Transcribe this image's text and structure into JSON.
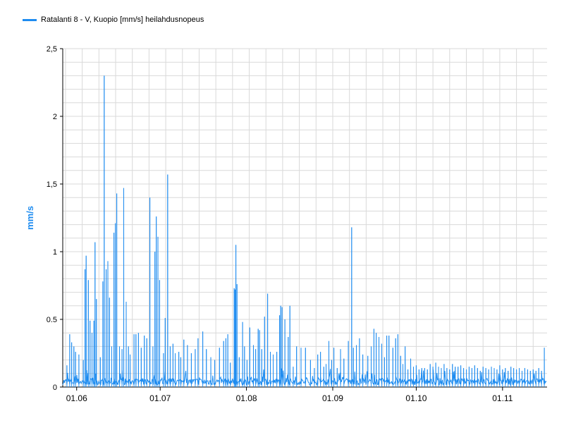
{
  "legend": {
    "label": "Ratalanti 8 - V, Kuopio [mm/s] heilahdusnopeus"
  },
  "colors": {
    "series": "#1e8cf0",
    "axis_label": "#1e8cf0",
    "grid": "#d9d9d9",
    "axis": "#000000"
  },
  "chart_data": {
    "type": "line",
    "title": "",
    "xlabel": "",
    "ylabel": "mm/s",
    "ylim": [
      0,
      2.5
    ],
    "yticks": [
      "0",
      "0.5",
      "1",
      "1,5",
      "2",
      "2,5"
    ],
    "ytick_values": [
      0,
      0.5,
      1,
      1.5,
      2,
      2.5
    ],
    "xticks": [
      "01.06",
      "01.07",
      "01.08",
      "01.09",
      "01.10",
      "01.11"
    ],
    "xtick_days": [
      31,
      61,
      92,
      123,
      153,
      184
    ],
    "xlim_days": [
      26,
      200
    ],
    "grid": true,
    "legend_position": "top-left",
    "series": [
      {
        "name": "Ratalanti 8 - V, Kuopio [mm/s] heilahdusnopeus",
        "spikes": [
          [
            27.5,
            0.16
          ],
          [
            28.5,
            0.39
          ],
          [
            29.2,
            0.33
          ],
          [
            30,
            0.3
          ],
          [
            30.6,
            0.26
          ],
          [
            31.8,
            0.24
          ],
          [
            33.4,
            0.2
          ],
          [
            34,
            0.87
          ],
          [
            34.4,
            0.97
          ],
          [
            35.2,
            0.79
          ],
          [
            35.8,
            0.49
          ],
          [
            36.5,
            0.4
          ],
          [
            37.2,
            0.49
          ],
          [
            37.6,
            1.07
          ],
          [
            38.1,
            0.65
          ],
          [
            39.5,
            0.22
          ],
          [
            40.4,
            0.78
          ],
          [
            40.9,
            2.3
          ],
          [
            41.6,
            0.87
          ],
          [
            42.2,
            0.93
          ],
          [
            42.8,
            0.66
          ],
          [
            43.6,
            0.3
          ],
          [
            44.4,
            1.14
          ],
          [
            44.9,
            1.21
          ],
          [
            45.4,
            1.43
          ],
          [
            46.4,
            0.3
          ],
          [
            47.3,
            0.28
          ],
          [
            47.9,
            1.47
          ],
          [
            48.8,
            0.63
          ],
          [
            49.6,
            0.3
          ],
          [
            50.2,
            0.24
          ],
          [
            51.6,
            0.39
          ],
          [
            52.3,
            0.39
          ],
          [
            53.2,
            0.4
          ],
          [
            54.2,
            0.29
          ],
          [
            55.3,
            0.38
          ],
          [
            56.2,
            0.36
          ],
          [
            57.3,
            1.4
          ],
          [
            58.4,
            0.3
          ],
          [
            59.1,
            1.0
          ],
          [
            59.6,
            1.26
          ],
          [
            60.2,
            1.11
          ],
          [
            60.8,
            0.79
          ],
          [
            62.2,
            0.25
          ],
          [
            62.8,
            0.51
          ],
          [
            63.7,
            1.57
          ],
          [
            64.6,
            0.3
          ],
          [
            65.6,
            0.32
          ],
          [
            66.4,
            0.25
          ],
          [
            67.7,
            0.26
          ],
          [
            68.4,
            0.22
          ],
          [
            69.5,
            0.35
          ],
          [
            70.8,
            0.31
          ],
          [
            72.2,
            0.25
          ],
          [
            73.6,
            0.28
          ],
          [
            74.6,
            0.36
          ],
          [
            76.3,
            0.41
          ],
          [
            77.6,
            0.28
          ],
          [
            79.2,
            0.22
          ],
          [
            80.6,
            0.2
          ],
          [
            82.3,
            0.29
          ],
          [
            83.8,
            0.34
          ],
          [
            84.6,
            0.36
          ],
          [
            85.3,
            0.39
          ],
          [
            86.2,
            0.18
          ],
          [
            87.6,
            0.73
          ],
          [
            87.9,
            0.72
          ],
          [
            88.2,
            1.05
          ],
          [
            88.6,
            0.76
          ],
          [
            89.4,
            0.22
          ],
          [
            90.6,
            0.48
          ],
          [
            91.3,
            0.3
          ],
          [
            92.2,
            0.2
          ],
          [
            93.2,
            0.44
          ],
          [
            94.5,
            0.31
          ],
          [
            95.3,
            0.28
          ],
          [
            96.2,
            0.43
          ],
          [
            96.7,
            0.42
          ],
          [
            97.5,
            0.28
          ],
          [
            98.5,
            0.52
          ],
          [
            99.6,
            0.69
          ],
          [
            100.6,
            0.26
          ],
          [
            101.6,
            0.24
          ],
          [
            102.9,
            0.26
          ],
          [
            103.9,
            0.53
          ],
          [
            104.3,
            0.6
          ],
          [
            104.8,
            0.59
          ],
          [
            105.8,
            0.5
          ],
          [
            107,
            0.37
          ],
          [
            107.6,
            0.6
          ],
          [
            108.8,
            0.15
          ],
          [
            110,
            0.3
          ],
          [
            111.6,
            0.29
          ],
          [
            113.2,
            0.29
          ],
          [
            115,
            0.2
          ],
          [
            116.4,
            0.14
          ],
          [
            117.6,
            0.24
          ],
          [
            118.6,
            0.26
          ],
          [
            119.8,
            0.15
          ],
          [
            120.6,
            0.17
          ],
          [
            121.6,
            0.34
          ],
          [
            122.6,
            0.2
          ],
          [
            123.4,
            0.29
          ],
          [
            124.6,
            0.14
          ],
          [
            125.8,
            0.28
          ],
          [
            127,
            0.21
          ],
          [
            128.6,
            0.34
          ],
          [
            129.8,
            1.18
          ],
          [
            130.4,
            0.29
          ],
          [
            131.5,
            0.31
          ],
          [
            132.6,
            0.36
          ],
          [
            133.8,
            0.24
          ],
          [
            135.6,
            0.23
          ],
          [
            136.8,
            0.3
          ],
          [
            137.8,
            0.43
          ],
          [
            138.6,
            0.4
          ],
          [
            139.6,
            0.37
          ],
          [
            140.6,
            0.32
          ],
          [
            141.6,
            0.22
          ],
          [
            142.4,
            0.38
          ],
          [
            143.2,
            0.38
          ],
          [
            144.6,
            0.29
          ],
          [
            145.6,
            0.36
          ],
          [
            146.4,
            0.39
          ],
          [
            147.4,
            0.23
          ],
          [
            148.2,
            0.17
          ],
          [
            149,
            0.3
          ],
          [
            150,
            0.13
          ],
          [
            151,
            0.21
          ],
          [
            152,
            0.15
          ],
          [
            153,
            0.16
          ],
          [
            154,
            0.13
          ],
          [
            155,
            0.14
          ],
          [
            156,
            0.14
          ],
          [
            157,
            0.13
          ],
          [
            158,
            0.17
          ],
          [
            159,
            0.15
          ],
          [
            160,
            0.18
          ],
          [
            161,
            0.15
          ],
          [
            162,
            0.14
          ],
          [
            163,
            0.17
          ],
          [
            164,
            0.14
          ],
          [
            165,
            0.13
          ],
          [
            166,
            0.17
          ],
          [
            167,
            0.15
          ],
          [
            168,
            0.15
          ],
          [
            169,
            0.16
          ],
          [
            170,
            0.14
          ],
          [
            171,
            0.13
          ],
          [
            172,
            0.15
          ],
          [
            173,
            0.14
          ],
          [
            174,
            0.16
          ],
          [
            175,
            0.14
          ],
          [
            176,
            0.12
          ],
          [
            177,
            0.15
          ],
          [
            178,
            0.14
          ],
          [
            179,
            0.13
          ],
          [
            180,
            0.15
          ],
          [
            181,
            0.14
          ],
          [
            182,
            0.13
          ],
          [
            183,
            0.16
          ],
          [
            184,
            0.13
          ],
          [
            185,
            0.14
          ],
          [
            186,
            0.12
          ],
          [
            187,
            0.15
          ],
          [
            188,
            0.14
          ],
          [
            189,
            0.13
          ],
          [
            190,
            0.14
          ],
          [
            191,
            0.12
          ],
          [
            192,
            0.14
          ],
          [
            193,
            0.13
          ],
          [
            194,
            0.12
          ],
          [
            195,
            0.13
          ],
          [
            196,
            0.12
          ],
          [
            197,
            0.14
          ],
          [
            198,
            0.12
          ],
          [
            199,
            0.29
          ]
        ]
      }
    ]
  }
}
